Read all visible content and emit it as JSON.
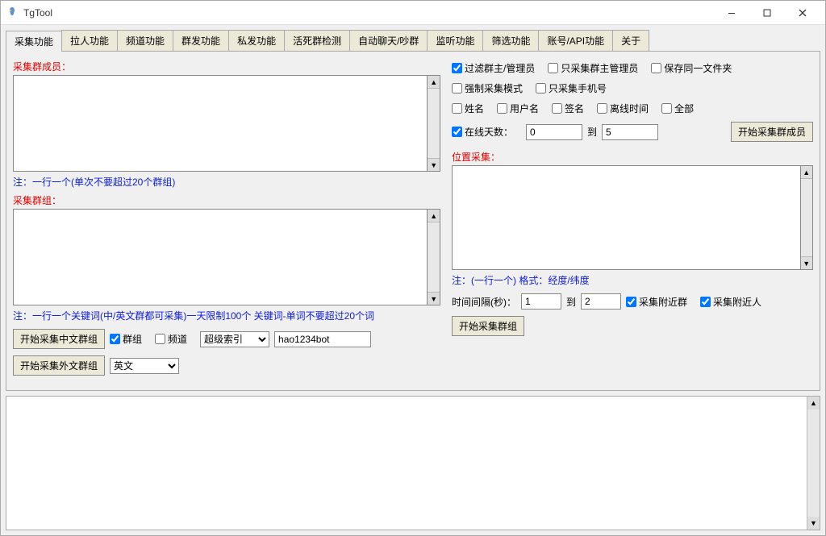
{
  "window": {
    "title": "TgTool"
  },
  "tabs": [
    "采集功能",
    "拉人功能",
    "频道功能",
    "群发功能",
    "私发功能",
    "活死群检测",
    "自动聊天/吵群",
    "监听功能",
    "筛选功能",
    "账号/API功能",
    "关于"
  ],
  "left": {
    "members_label": "采集群成员：",
    "members_note": "注：一行一个(单次不要超过20个群组)",
    "groups_label": "采集群组：",
    "groups_note": "注：一行一个关键词(中/英文群都可采集)一天限制100个 关键词-单词不要超过20个词",
    "btn_collect_cn": "开始采集中文群组",
    "btn_collect_fr": "开始采集外文群组",
    "ck_qunzu": "群组",
    "ck_pindao": "频道",
    "select_index": "超级索引",
    "index_options": [
      "超级索引"
    ],
    "bot_value": "hao1234bot",
    "lang_value": "英文",
    "lang_options": [
      "英文"
    ]
  },
  "right": {
    "ck_filter_admin": "过滤群主/管理员",
    "ck_only_admin": "只采集群主管理员",
    "ck_save_same": "保存同一文件夹",
    "ck_force": "强制采集模式",
    "ck_only_phone": "只采集手机号",
    "ck_xingming": "姓名",
    "ck_username": "用户名",
    "ck_qianming": "签名",
    "ck_offline": "离线时间",
    "ck_all": "全部",
    "ck_online_days": "在线天数：",
    "days_from": "0",
    "lbl_to": "到",
    "days_to": "5",
    "btn_start_members": "开始采集群成员",
    "loc_label": "位置采集：",
    "loc_note": "注：(一行一个) 格式：经度/纬度",
    "interval_label": "时间间隔(秒)：",
    "interval_from": "1",
    "interval_to": "2",
    "ck_near_group": "采集附近群",
    "ck_near_people": "采集附近人",
    "btn_start_groups": "开始采集群组"
  }
}
